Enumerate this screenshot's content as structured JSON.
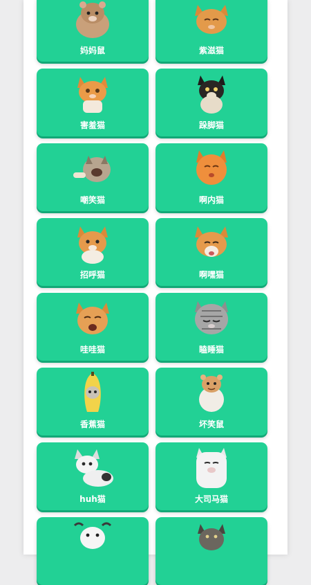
{
  "cards": [
    {
      "label": "妈妈鼠",
      "icon": "hamster-icon"
    },
    {
      "label": "紫滋猫",
      "icon": "orange-cat-icon"
    },
    {
      "label": "害羞猫",
      "icon": "orange-cat-icon"
    },
    {
      "label": "跺脚猫",
      "icon": "black-cat-icon"
    },
    {
      "label": "嘲笑猫",
      "icon": "laughing-cat-icon"
    },
    {
      "label": "啊内猫",
      "icon": "orange-cat-icon"
    },
    {
      "label": "招呼猫",
      "icon": "orange-white-cat-icon"
    },
    {
      "label": "啊嘿猫",
      "icon": "orange-white-cat-icon"
    },
    {
      "label": "哇哇猫",
      "icon": "orange-cat-icon"
    },
    {
      "label": "瞌睡猫",
      "icon": "tabby-cat-icon"
    },
    {
      "label": "香蕉猫",
      "icon": "banana-cat-icon"
    },
    {
      "label": "坏笑鼠",
      "icon": "hamster-icon"
    },
    {
      "label": "huh猫",
      "icon": "white-cat-icon"
    },
    {
      "label": "大司马猫",
      "icon": "white-cat-icon"
    },
    {
      "label": "",
      "icon": "goat-icon"
    },
    {
      "label": "",
      "icon": "gray-cat-icon"
    }
  ],
  "colors": {
    "card": "#22d195",
    "card_shadow": "#12a877",
    "panel": "#ffffff",
    "background": "#ededee"
  }
}
